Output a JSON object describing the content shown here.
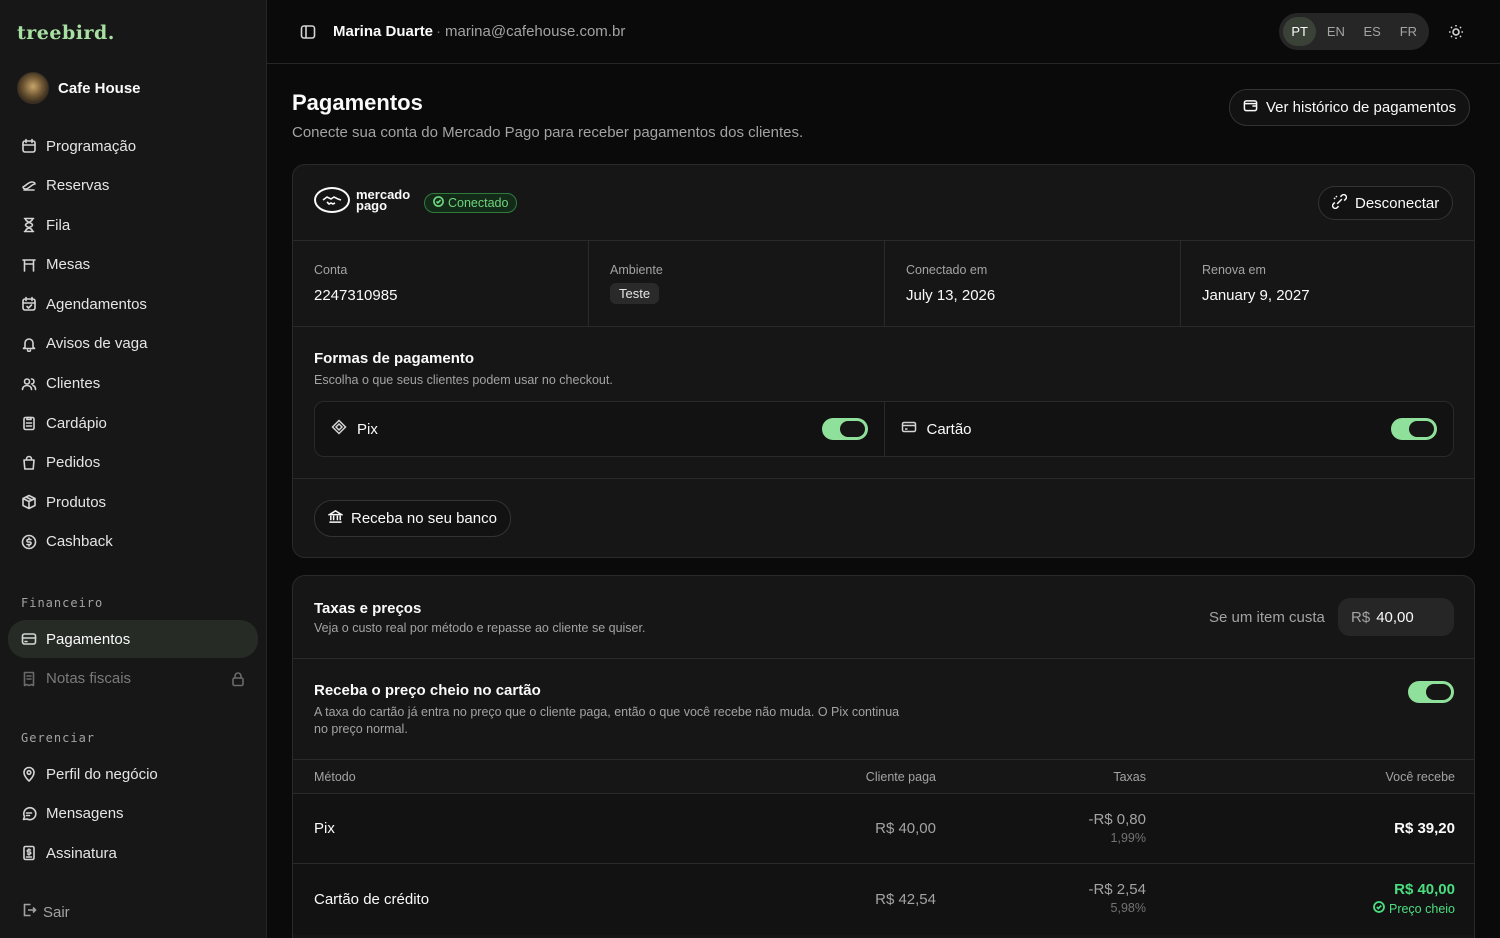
{
  "sidebar": {
    "brand": "treebird.",
    "org_name": "Cafe House",
    "nav_main": [
      {
        "label": "Programação",
        "icon": "calendar-icon"
      },
      {
        "label": "Reservas",
        "icon": "ticket-icon"
      },
      {
        "label": "Fila",
        "icon": "hourglass-icon"
      },
      {
        "label": "Mesas",
        "icon": "table-icon"
      },
      {
        "label": "Agendamentos",
        "icon": "calendar-check-icon"
      },
      {
        "label": "Avisos de vaga",
        "icon": "bell-icon"
      },
      {
        "label": "Clientes",
        "icon": "users-icon"
      },
      {
        "label": "Cardápio",
        "icon": "clipboard-icon"
      },
      {
        "label": "Pedidos",
        "icon": "shopping-bag-icon"
      },
      {
        "label": "Produtos",
        "icon": "package-icon"
      },
      {
        "label": "Cashback",
        "icon": "dollar-circle-icon"
      }
    ],
    "section_financeiro": "Financeiro",
    "nav_financeiro": [
      {
        "label": "Pagamentos",
        "icon": "wallet-icon",
        "active": true
      },
      {
        "label": "Notas fiscais",
        "icon": "receipt-icon",
        "disabled": true
      }
    ],
    "section_gerenciar": "Gerenciar",
    "nav_gerenciar": [
      {
        "label": "Perfil do negócio",
        "icon": "map-pin-icon"
      },
      {
        "label": "Mensagens",
        "icon": "message-icon"
      },
      {
        "label": "Assinatura",
        "icon": "receipt-dollar-icon"
      }
    ],
    "logout": "Sair"
  },
  "topbar": {
    "user_name": "Marina Duarte",
    "separator": "·",
    "user_email": "marina@cafehouse.com.br",
    "languages": [
      "PT",
      "EN",
      "ES",
      "FR"
    ],
    "selected_language": "PT"
  },
  "page": {
    "title": "Pagamentos",
    "subtitle": "Conecte sua conta do Mercado Pago para receber pagamentos dos clientes.",
    "history_button": "Ver histórico de pagamentos"
  },
  "connection": {
    "provider_line1": "mercado",
    "provider_line2": "pago",
    "status": "Conectado",
    "disconnect_button": "Desconectar",
    "stats": [
      {
        "label": "Conta",
        "value": "2247310985"
      },
      {
        "label": "Ambiente",
        "value": "Teste"
      },
      {
        "label": "Conectado em",
        "value": "July 13, 2026"
      },
      {
        "label": "Renova em",
        "value": "January 9, 2027"
      }
    ],
    "methods_title": "Formas de pagamento",
    "methods_subtitle": "Escolha o que seus clientes podem usar no checkout.",
    "methods": [
      {
        "label": "Pix",
        "enabled": true
      },
      {
        "label": "Cartão",
        "enabled": true
      }
    ],
    "bank_button": "Receba no seu banco"
  },
  "fees": {
    "title": "Taxas e preços",
    "subtitle": "Veja o custo real por método e repasse ao cliente se quiser.",
    "price_label": "Se um item custa",
    "currency": "R$",
    "price_value": "40,00",
    "full_price_title": "Receba o preço cheio no cartão",
    "full_price_desc_1": "A taxa do cartão já entra no preço que o cliente paga, então o que você recebe não muda. O Pix continua",
    "full_price_desc_2": "no preço normal.",
    "full_price_enabled": true,
    "columns": [
      "Método",
      "Cliente paga",
      "Taxas",
      "Você recebe"
    ],
    "rows": [
      {
        "method": "Pix",
        "client_pays": "R$ 40,00",
        "fee": "-R$ 0,80",
        "fee_pct": "1,99%",
        "receive": "R$ 39,20",
        "note": ""
      },
      {
        "method": "Cartão de crédito",
        "client_pays": "R$ 42,54",
        "fee": "-R$ 2,54",
        "fee_pct": "5,98%",
        "receive": "R$ 40,00",
        "note": "Preço cheio"
      }
    ]
  }
}
